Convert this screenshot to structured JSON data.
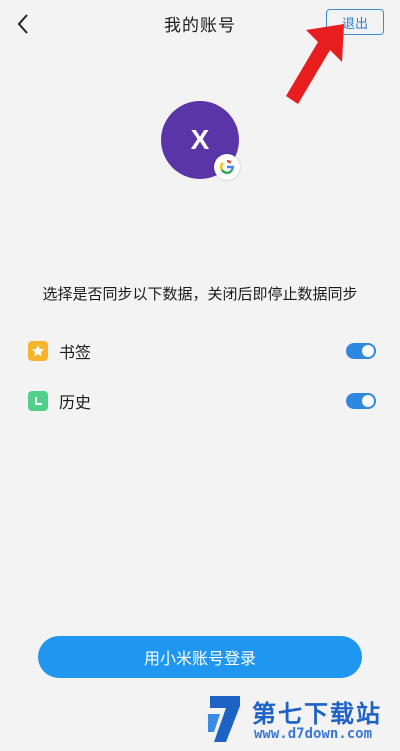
{
  "header": {
    "back_icon": "chevron-left-icon",
    "title": "我的账号",
    "logout_label": "退出"
  },
  "annotation": {
    "arrow_icon": "red-arrow-icon",
    "arrow_color": "#e81d1d"
  },
  "profile": {
    "avatar_letter": "X",
    "avatar_color": "#5a35a7",
    "badge_icon": "google-icon"
  },
  "sync": {
    "description": "选择是否同步以下数据，关闭后即停止数据同步",
    "items": [
      {
        "label": "书签",
        "icon": "star-icon",
        "icon_color": "#f7b52c",
        "enabled": true
      },
      {
        "label": "历史",
        "icon": "clock-icon",
        "icon_color": "#4fcf8a",
        "enabled": true
      }
    ],
    "toggle_color": "#2e88e0"
  },
  "login": {
    "label": "用小米账号登录",
    "color": "#1f96f0"
  },
  "watermark": {
    "title": "第七下载站",
    "url": "www.d7down.com"
  }
}
